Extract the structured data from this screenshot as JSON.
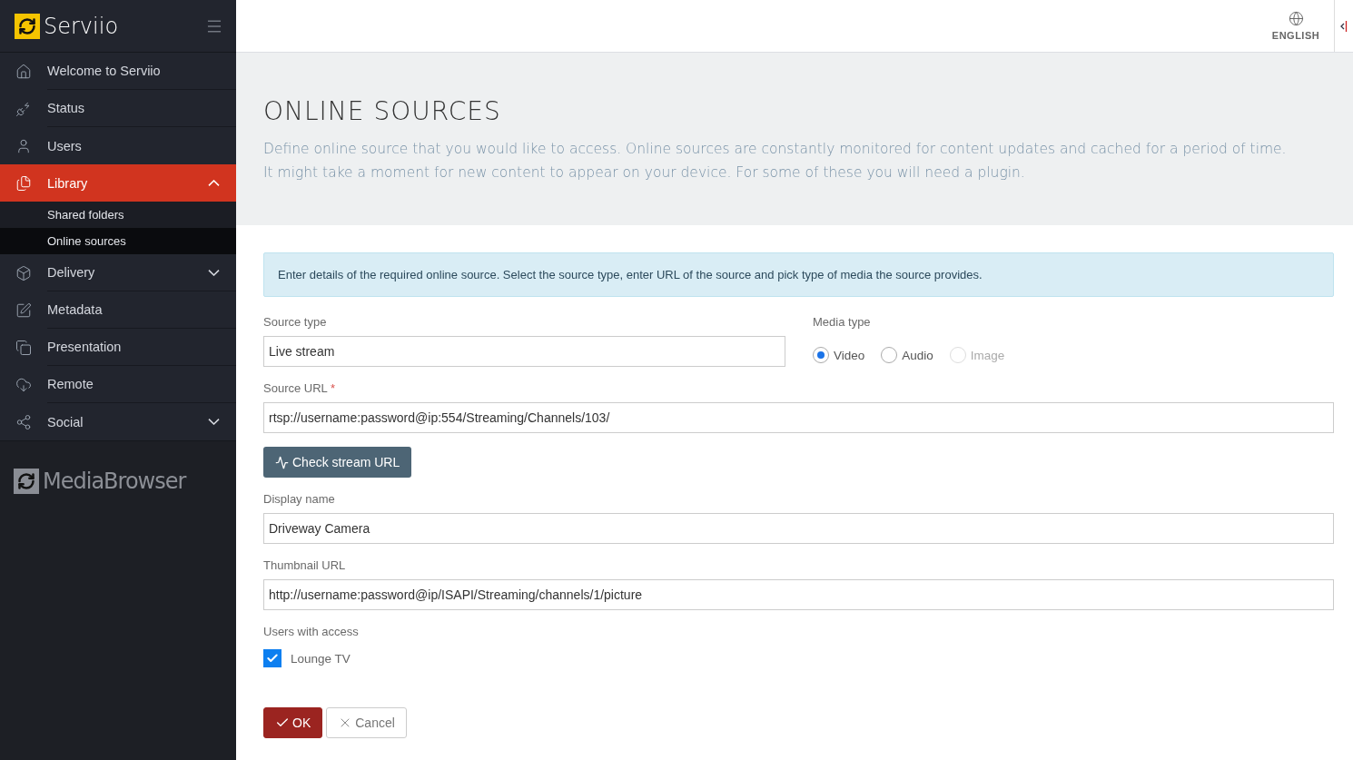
{
  "brand": {
    "name": "Serviio"
  },
  "sidebar": {
    "items": [
      {
        "label": "Welcome to Serviio",
        "selected": false
      },
      {
        "label": "Status",
        "selected": false
      },
      {
        "label": "Users",
        "selected": false
      },
      {
        "label": "Library",
        "selected": true,
        "expanded": true,
        "children": [
          {
            "label": "Shared folders",
            "selected": false
          },
          {
            "label": "Online sources",
            "selected": true
          }
        ]
      },
      {
        "label": "Delivery",
        "selected": false,
        "expanded": false
      },
      {
        "label": "Metadata",
        "selected": false
      },
      {
        "label": "Presentation",
        "selected": false
      },
      {
        "label": "Remote",
        "selected": false
      },
      {
        "label": "Social",
        "selected": false,
        "expanded": false
      }
    ],
    "footer_logo": "MediaBrowser"
  },
  "topbar": {
    "language": "ENGLISH"
  },
  "page": {
    "title": "ONLINE SOURCES",
    "description": "Define online source that you would like to access. Online sources are constantly monitored for content updates and cached for a period of time. It might take a moment for new content to appear on your device. For some of these you will need a plugin."
  },
  "form": {
    "info": "Enter details of the required online source. Select the source type, enter URL of the source and pick type of media the source provides.",
    "source_type": {
      "label": "Source type",
      "value": "Live stream"
    },
    "media_type": {
      "label": "Media type",
      "options": [
        {
          "label": "Video",
          "selected": true,
          "disabled": false
        },
        {
          "label": "Audio",
          "selected": false,
          "disabled": false
        },
        {
          "label": "Image",
          "selected": false,
          "disabled": true
        }
      ]
    },
    "source_url": {
      "label": "Source URL",
      "required": true,
      "required_mark": "*",
      "value": "rtsp://username:password@ip:554/Streaming/Channels/103/"
    },
    "check_button": "Check stream URL",
    "display_name": {
      "label": "Display name",
      "value": "Driveway Camera"
    },
    "thumbnail_url": {
      "label": "Thumbnail URL",
      "value": "http://username:password@ip/ISAPI/Streaming/channels/1/picture"
    },
    "users": {
      "label": "Users with access",
      "items": [
        {
          "label": "Lounge TV",
          "checked": true
        }
      ]
    },
    "buttons": [
      {
        "label": "OK",
        "kind": "primary"
      },
      {
        "label": "Cancel",
        "kind": "secondary"
      }
    ]
  }
}
